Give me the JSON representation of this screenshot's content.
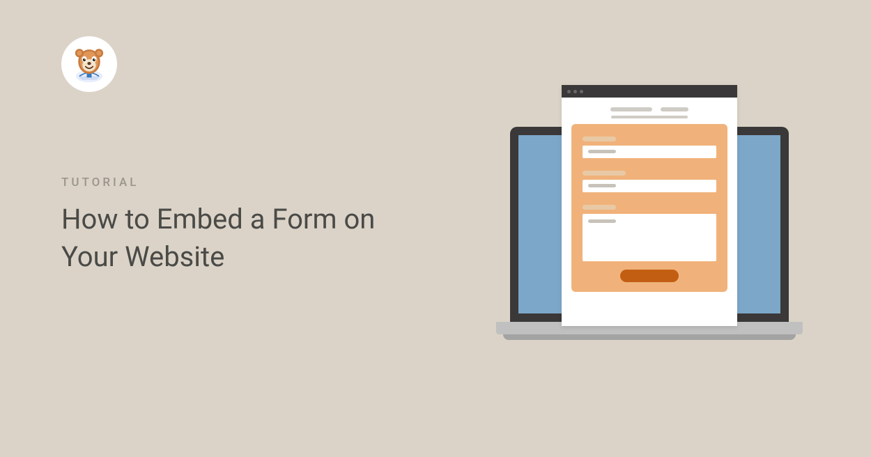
{
  "eyebrow": "TUTORIAL",
  "title": "How to Embed a Form on Your Website",
  "logo": {
    "name": "wpforms-mascot"
  },
  "colors": {
    "bg": "#dbd3c7",
    "heading": "#4a4a47",
    "eyebrow": "#9a958c",
    "laptop_screen": "#7ca7c9",
    "form_panel": "#f0b27a",
    "button": "#c25e12"
  }
}
